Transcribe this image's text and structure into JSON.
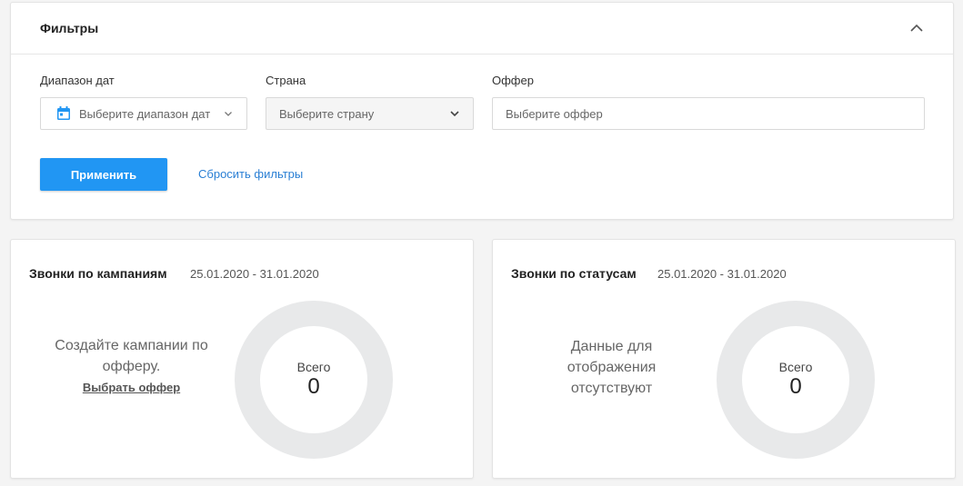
{
  "filters": {
    "title": "Фильтры",
    "date_range": {
      "label": "Диапазон дат",
      "placeholder": "Выберите диапазон дат"
    },
    "country": {
      "label": "Страна",
      "placeholder": "Выберите страну"
    },
    "offer": {
      "label": "Оффер",
      "placeholder": "Выберите оффер"
    },
    "apply_label": "Применить",
    "reset_label": "Сбросить фильтры"
  },
  "calls_by_campaigns": {
    "title": "Звонки по кампаниям",
    "date_range": "25.01.2020 - 31.01.2020",
    "empty_text": "Создайте кампании по офферу.",
    "empty_link": "Выбрать оффер",
    "total_label": "Всего",
    "total_value": "0"
  },
  "calls_by_statuses": {
    "title": "Звонки по статусам",
    "date_range": "25.01.2020 - 31.01.2020",
    "empty_text": "Данные для отображения отсутствуют",
    "total_label": "Всего",
    "total_value": "0"
  },
  "colors": {
    "primary": "#2196f3",
    "link": "#2a7fd4",
    "donut_ring": "#e8e9ea"
  }
}
